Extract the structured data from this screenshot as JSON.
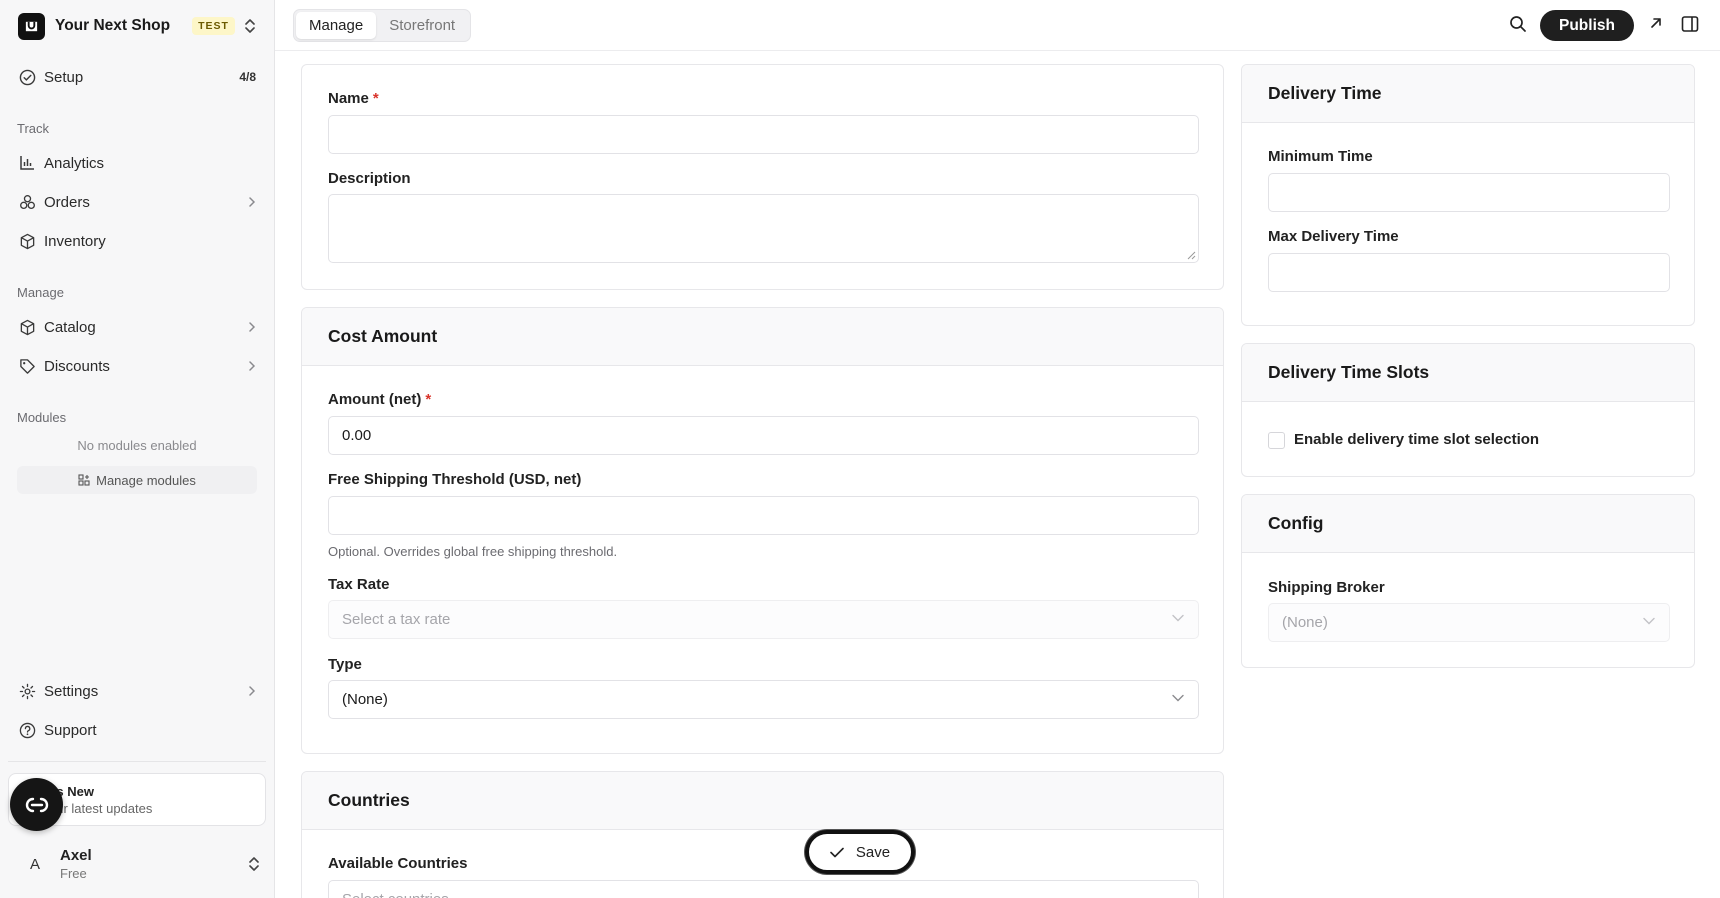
{
  "app": {
    "shop_name": "Your Next Shop",
    "env_badge": "TEST"
  },
  "sidebar": {
    "setup": {
      "label": "Setup",
      "count": "4/8"
    },
    "track_label": "Track",
    "track_items": [
      {
        "label": "Analytics",
        "icon": "bar-chart-icon"
      },
      {
        "label": "Orders",
        "icon": "orders-icon"
      },
      {
        "label": "Inventory",
        "icon": "box-icon"
      }
    ],
    "manage_label": "Manage",
    "manage_items": [
      {
        "label": "Catalog",
        "icon": "box-icon"
      },
      {
        "label": "Discounts",
        "icon": "tag-icon"
      }
    ],
    "modules_label": "Modules",
    "no_modules": "No modules enabled",
    "manage_modules": "Manage modules",
    "bottom_items": [
      {
        "label": "Settings",
        "icon": "gear-icon"
      },
      {
        "label": "Support",
        "icon": "help-icon"
      }
    ],
    "whats_new": {
      "title": "t's New",
      "subtitle": "our latest updates"
    },
    "user": {
      "initial": "A",
      "name": "Axel",
      "plan": "Free"
    }
  },
  "topbar": {
    "tabs": [
      {
        "label": "Manage",
        "active": true
      },
      {
        "label": "Storefront",
        "active": false
      }
    ],
    "publish_label": "Publish"
  },
  "form": {
    "name": {
      "label": "Name",
      "required": "*",
      "value": ""
    },
    "description": {
      "label": "Description",
      "value": ""
    },
    "cost": {
      "title": "Cost Amount",
      "amount": {
        "label": "Amount (net)",
        "required": "*",
        "value": "0.00"
      },
      "free_shipping": {
        "label": "Free Shipping Threshold (USD, net)",
        "value": "",
        "hint": "Optional. Overrides global free shipping threshold."
      },
      "tax_rate": {
        "label": "Tax Rate",
        "placeholder": "Select a tax rate"
      },
      "type": {
        "label": "Type",
        "value": "(None)"
      }
    },
    "countries": {
      "title": "Countries",
      "available": {
        "label": "Available Countries",
        "placeholder": "Select countries"
      }
    }
  },
  "right": {
    "delivery_time": {
      "title": "Delivery Time",
      "min_label": "Minimum Time",
      "max_label": "Max Delivery Time"
    },
    "slots": {
      "title": "Delivery Time Slots",
      "checkbox_label": "Enable delivery time slot selection"
    },
    "config": {
      "title": "Config",
      "broker_label": "Shipping Broker",
      "broker_value": "(None)"
    }
  },
  "save_label": "Save"
}
